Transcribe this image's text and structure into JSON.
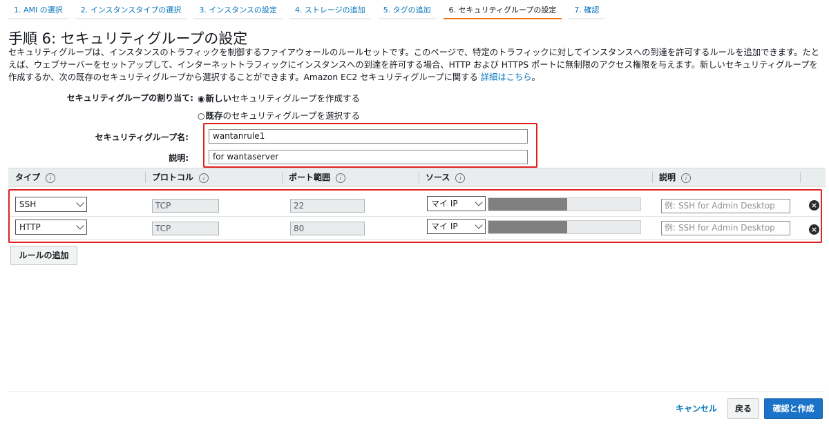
{
  "tabs": [
    {
      "label": "1. AMI の選択",
      "active": false
    },
    {
      "label": "2. インスタンスタイプの選択",
      "active": false
    },
    {
      "label": "3. インスタンスの設定",
      "active": false
    },
    {
      "label": "4. ストレージの追加",
      "active": false
    },
    {
      "label": "5. タグの追加",
      "active": false
    },
    {
      "label": "6. セキュリティグループの設定",
      "active": true
    },
    {
      "label": "7. 確認",
      "active": false
    }
  ],
  "page": {
    "title": "手順 6: セキュリティグループの設定",
    "description": "セキュリティグループは、インスタンスのトラフィックを制御するファイアウォールのルールセットです。このページで、特定のトラフィックに対してインスタンスへの到達を許可するルールを追加できます。たとえば、ウェブサーバーをセットアップして、インターネットトラフィックにインスタンスへの到達を許可する場合、HTTP および HTTPS ポートに無制限のアクセス権限を与えます。新しいセキュリティグループを作成するか、次の既存のセキュリティグループから選択することができます。Amazon EC2 セキュリティグループに関する",
    "description_link": "詳細はこちら",
    "description_end": "。"
  },
  "form": {
    "assign_label": "セキュリティグループの割り当て:",
    "radio_new_bold": "新しい",
    "radio_new_rest": "セキュリティグループを作成する",
    "radio_existing_bold": "既存",
    "radio_existing_rest": "のセキュリティグループを選択する",
    "radio_selected": "new",
    "name_label": "セキュリティグループ名:",
    "name_value": "wantanrule1",
    "desc_label": "説明:",
    "desc_value": "for wantaserver"
  },
  "table": {
    "headers": {
      "type": "タイプ",
      "protocol": "プロトコル",
      "port_range": "ポート範囲",
      "source": "ソース",
      "description": "説明"
    },
    "info_glyph": "i",
    "rules": [
      {
        "type": "SSH",
        "protocol": "TCP",
        "port": "22",
        "source": "マイ IP",
        "desc_placeholder": "例: SSH for Admin Desktop"
      },
      {
        "type": "HTTP",
        "protocol": "TCP",
        "port": "80",
        "source": "マイ IP",
        "desc_placeholder": "例: SSH for Admin Desktop"
      }
    ]
  },
  "add_rule_label": "ルールの追加",
  "footer": {
    "cancel": "キャンセル",
    "back": "戻る",
    "review_launch": "確認と作成"
  },
  "colors": {
    "accent": "#0073bb",
    "active_tab_underline": "#ec7211",
    "highlight_box": "#e02020",
    "primary_button": "#1a73c8"
  }
}
